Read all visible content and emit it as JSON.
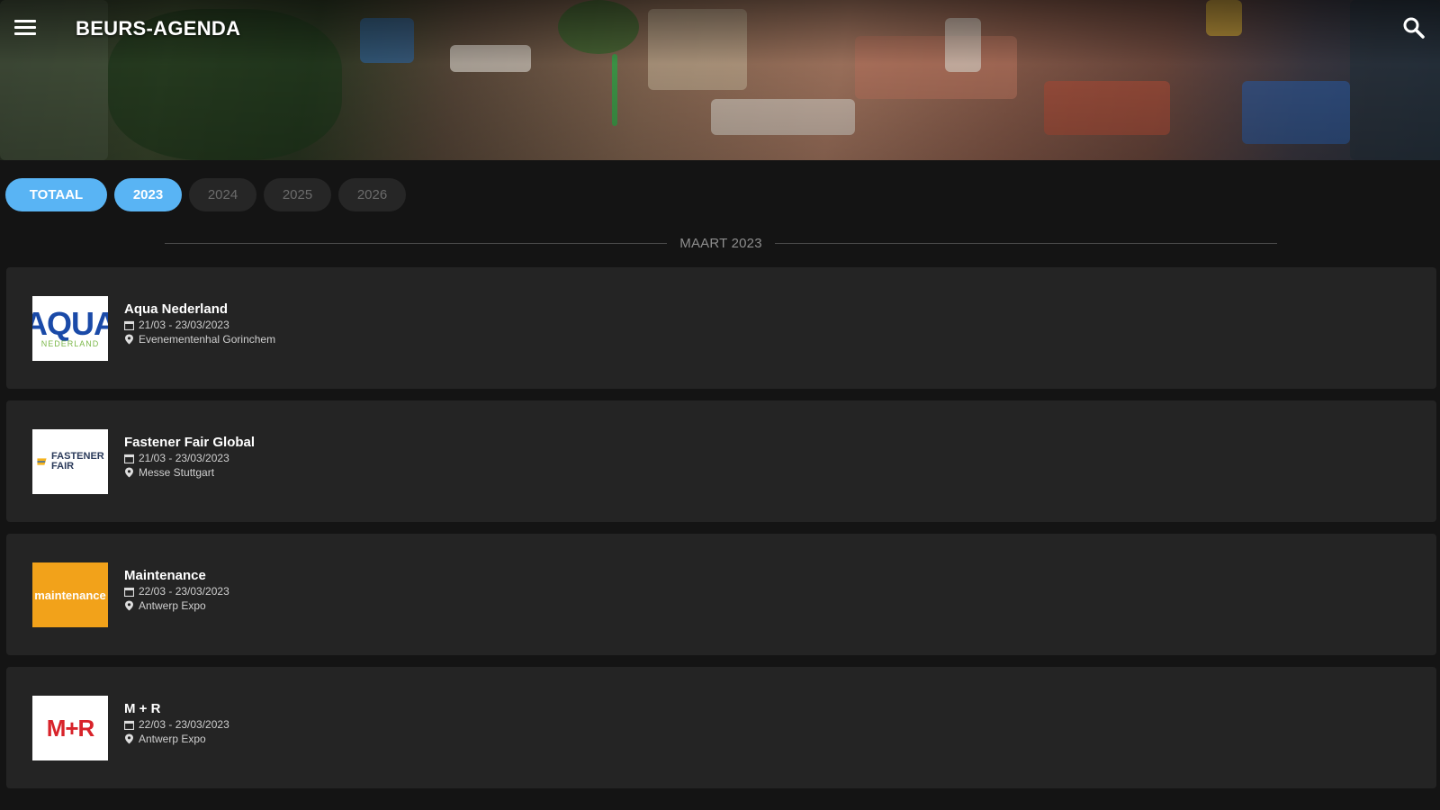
{
  "app": {
    "title": "BEURS-AGENDA"
  },
  "filters": {
    "chips": [
      {
        "label": "TOTAAL",
        "active": true
      },
      {
        "label": "2023",
        "active": true
      },
      {
        "label": "2024",
        "active": false
      },
      {
        "label": "2025",
        "active": false
      },
      {
        "label": "2026",
        "active": false
      }
    ]
  },
  "section": {
    "month_label": "MAART 2023"
  },
  "events": [
    {
      "name": "Aqua Nederland",
      "dates": "21/03 - 23/03/2023",
      "location": "Evenementenhal Gorinchem",
      "logo": {
        "text": "AQUA",
        "subtext": "NEDERLAND"
      }
    },
    {
      "name": "Fastener Fair Global",
      "dates": "21/03 - 23/03/2023",
      "location": "Messe Stuttgart",
      "logo": {
        "text": "FASTENER FAIR"
      }
    },
    {
      "name": "Maintenance",
      "dates": "22/03 - 23/03/2023",
      "location": "Antwerp Expo",
      "logo": {
        "text": "maintenance"
      }
    },
    {
      "name": "M + R",
      "dates": "22/03 - 23/03/2023",
      "location": "Antwerp Expo",
      "logo": {
        "text": "M+R"
      }
    }
  ],
  "colors": {
    "accent": "#59b4f4",
    "background": "#141414",
    "card": "#242424"
  },
  "icons": {
    "menu": "menu-icon",
    "search": "search-icon",
    "calendar": "calendar-icon",
    "location": "location-pin-icon"
  }
}
